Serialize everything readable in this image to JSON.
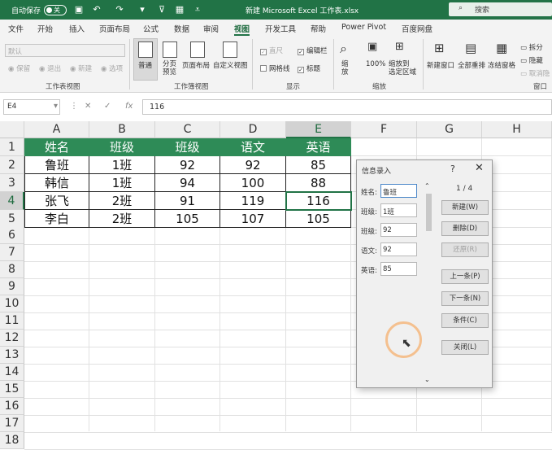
{
  "titlebar": {
    "autosave": "自动保存",
    "toggle": "关",
    "title": "新建 Microsoft Excel 工作表.xlsx",
    "search": "搜索"
  },
  "tabs": [
    "文件",
    "开始",
    "插入",
    "页面布局",
    "公式",
    "数据",
    "审阅",
    "视图",
    "开发工具",
    "帮助",
    "Power Pivot",
    "百度网盘"
  ],
  "active_tab": "视图",
  "ribbon": {
    "sheet_view": {
      "dropdown": "默认",
      "keep": "保留",
      "exit": "退出",
      "new": "新建",
      "options": "选项",
      "label": "工作表视图"
    },
    "workbook_views": {
      "normal": "普通",
      "page_break": "分页\n预览",
      "page_layout": "页面布局",
      "custom": "自定义视图",
      "label": "工作簿视图"
    },
    "show": {
      "ruler": "直尺",
      "formula_bar": "编辑栏",
      "gridlines": "网格线",
      "headings": "标题",
      "label": "显示"
    },
    "zoom": {
      "zoom": "缩\n放",
      "zoom100": "100%",
      "zoom_selection": "缩放到\n选定区域",
      "label": "缩放"
    },
    "window": {
      "new_window": "新建窗口",
      "arrange_all": "全部重排",
      "freeze": "冻结窗格",
      "split": "拆分",
      "hide": "隐藏",
      "unhide": "取消隐",
      "label": "窗口"
    }
  },
  "formula_bar": {
    "name_box": "E4",
    "fx": "fx",
    "value": "116"
  },
  "columns": [
    "A",
    "B",
    "C",
    "D",
    "E",
    "F",
    "G",
    "H"
  ],
  "selected_column": "E",
  "rows": [
    "1",
    "2",
    "3",
    "4",
    "5",
    "6",
    "7",
    "8",
    "9",
    "10",
    "11",
    "12",
    "13",
    "14",
    "15",
    "16",
    "17",
    "18"
  ],
  "selected_row": "4",
  "table": {
    "headers": [
      "姓名",
      "班级",
      "班级",
      "语文",
      "英语"
    ],
    "data": [
      [
        "鲁班",
        "1班",
        "92",
        "92",
        "85"
      ],
      [
        "韩信",
        "1班",
        "94",
        "100",
        "88"
      ],
      [
        "张飞",
        "2班",
        "91",
        "119",
        "116"
      ],
      [
        "李白",
        "2班",
        "105",
        "107",
        "105"
      ]
    ]
  },
  "dialog": {
    "title": "信息录入",
    "help": "?",
    "close": "✕",
    "counter": "1 / 4",
    "fields": [
      {
        "label": "姓名:",
        "value": "鲁班"
      },
      {
        "label": "班级:",
        "value": "1班"
      },
      {
        "label": "班级:",
        "value": "92"
      },
      {
        "label": "语文:",
        "value": "92"
      },
      {
        "label": "英语:",
        "value": "85"
      }
    ],
    "buttons": [
      {
        "label": "新建(W)",
        "disabled": false
      },
      {
        "label": "删除(D)",
        "disabled": false
      },
      {
        "label": "还原(R)",
        "disabled": true
      },
      {
        "label": "上一条(P)",
        "disabled": false
      },
      {
        "label": "下一条(N)",
        "disabled": false
      },
      {
        "label": "条件(C)",
        "disabled": false
      },
      {
        "label": "关闭(L)",
        "disabled": false
      }
    ]
  }
}
